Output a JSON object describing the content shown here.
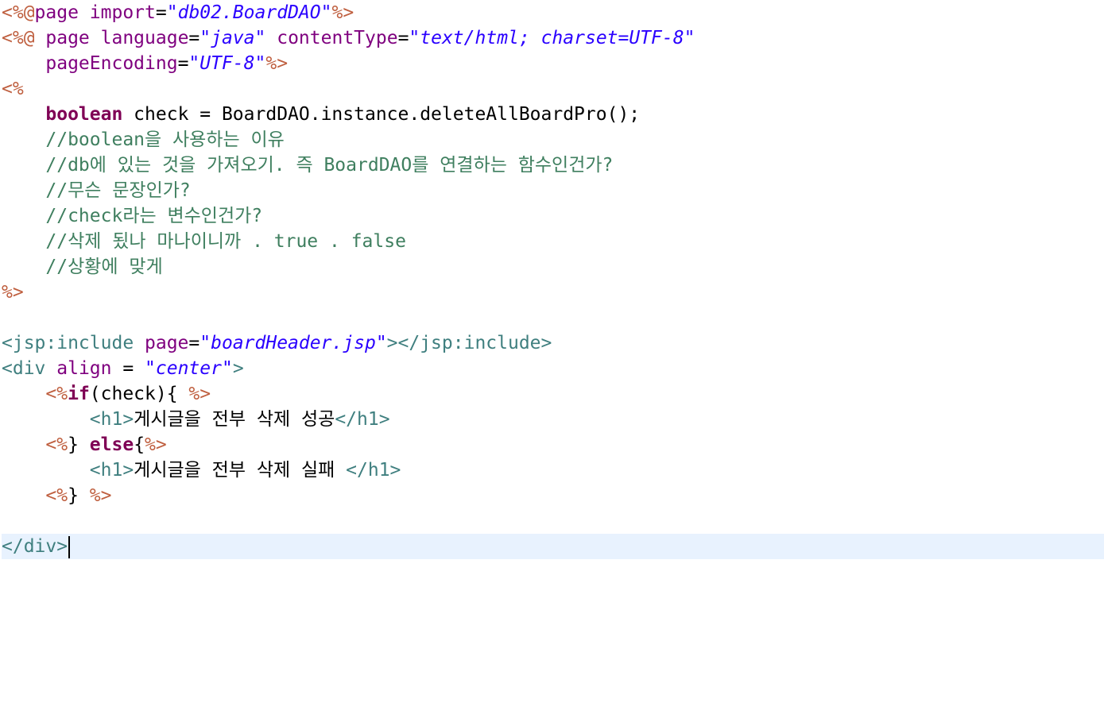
{
  "editor": {
    "accent_colors": {
      "jsp_delimiter": "#bf5f3f",
      "attribute": "#7f007f",
      "string": "#2a00ff",
      "keyword": "#7f0055",
      "comment": "#3f7f5f",
      "html_tag": "#3f7f7f",
      "current_line_highlight": "#e8f2fe"
    },
    "lines": [
      [
        [
          "jsp",
          "<%@"
        ],
        [
          "attr",
          "page "
        ],
        [
          "attr",
          "import"
        ],
        [
          "plain",
          "="
        ],
        [
          "str",
          "\"db02.BoardDAO\""
        ],
        [
          "jsp",
          "%>"
        ]
      ],
      [
        [
          "jsp",
          "<%@ "
        ],
        [
          "attr",
          "page "
        ],
        [
          "attr",
          "language"
        ],
        [
          "plain",
          "="
        ],
        [
          "str",
          "\"java\""
        ],
        [
          "plain",
          " "
        ],
        [
          "attr",
          "contentType"
        ],
        [
          "plain",
          "="
        ],
        [
          "str",
          "\"text/html; charset=UTF-8\""
        ]
      ],
      [
        [
          "plain",
          "    "
        ],
        [
          "attr",
          "pageEncoding"
        ],
        [
          "plain",
          "="
        ],
        [
          "str",
          "\"UTF-8\""
        ],
        [
          "jsp",
          "%>"
        ]
      ],
      [
        [
          "jsp",
          "<%"
        ]
      ],
      [
        [
          "plain",
          "    "
        ],
        [
          "kw",
          "boolean"
        ],
        [
          "plain",
          " check = BoardDAO.instance.deleteAllBoardPro();"
        ]
      ],
      [
        [
          "plain",
          "    "
        ],
        [
          "cmt",
          "//boolean을 사용하는 이유"
        ]
      ],
      [
        [
          "plain",
          "    "
        ],
        [
          "cmt",
          "//db에 있는 것을 가져오기. 즉 BoardDAO를 연결하는 함수인건가?"
        ]
      ],
      [
        [
          "plain",
          "    "
        ],
        [
          "cmt",
          "//무슨 문장인가?"
        ]
      ],
      [
        [
          "plain",
          "    "
        ],
        [
          "cmt",
          "//check라는 변수인건가?"
        ]
      ],
      [
        [
          "plain",
          "    "
        ],
        [
          "cmt",
          "//삭제 됬나 마나이니까 . true . false"
        ]
      ],
      [
        [
          "plain",
          "    "
        ],
        [
          "cmt",
          "//상황에 맞게"
        ]
      ],
      [
        [
          "jsp",
          "%>"
        ]
      ],
      [],
      [
        [
          "tag",
          "<jsp:include "
        ],
        [
          "attr",
          "page"
        ],
        [
          "plain",
          "="
        ],
        [
          "str",
          "\"boardHeader.jsp\""
        ],
        [
          "tag",
          "></jsp:include>"
        ]
      ],
      [
        [
          "tag",
          "<div "
        ],
        [
          "attr",
          "align"
        ],
        [
          "plain",
          " = "
        ],
        [
          "str",
          "\"center\""
        ],
        [
          "tag",
          ">"
        ]
      ],
      [
        [
          "plain",
          "    "
        ],
        [
          "jsp",
          "<%"
        ],
        [
          "kw",
          "if"
        ],
        [
          "plain",
          "(check){ "
        ],
        [
          "jsp",
          "%>"
        ]
      ],
      [
        [
          "plain",
          "        "
        ],
        [
          "tag",
          "<h1>"
        ],
        [
          "plain",
          "게시글을 전부 삭제 성공"
        ],
        [
          "tag",
          "</h1>"
        ]
      ],
      [
        [
          "plain",
          "    "
        ],
        [
          "jsp",
          "<%"
        ],
        [
          "plain",
          "} "
        ],
        [
          "kw",
          "else"
        ],
        [
          "plain",
          "{"
        ],
        [
          "jsp",
          "%>"
        ]
      ],
      [
        [
          "plain",
          "        "
        ],
        [
          "tag",
          "<h1>"
        ],
        [
          "plain",
          "게시글을 전부 삭제 실패 "
        ],
        [
          "tag",
          "</h1>"
        ]
      ],
      [
        [
          "plain",
          "    "
        ],
        [
          "jsp",
          "<%"
        ],
        [
          "plain",
          "} "
        ],
        [
          "jsp",
          "%>"
        ]
      ],
      [],
      [
        [
          "tag",
          "</div>"
        ]
      ]
    ],
    "caret_line": 21
  }
}
